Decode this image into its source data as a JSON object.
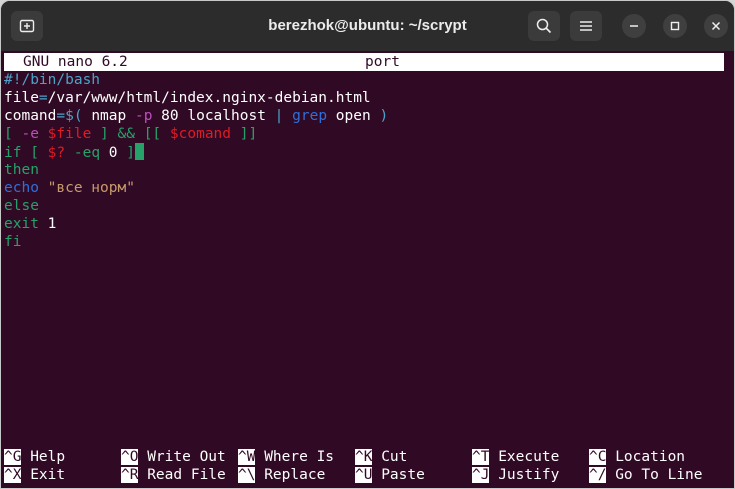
{
  "window": {
    "title": "berezhok@ubuntu: ~/scrypt",
    "icons": [
      "new-tab-icon",
      "search-icon",
      "hamburger-menu-icon",
      "minimize-icon",
      "maximize-icon",
      "close-icon"
    ]
  },
  "nano": {
    "version": "GNU nano 6.2",
    "filename": "port"
  },
  "code_lines": [
    [
      {
        "t": "#!/bin/bash",
        "c": "#4ba2c9"
      }
    ],
    [
      {
        "t": "file",
        "c": "#ffffff"
      },
      {
        "t": "=",
        "c": "#4ba2c9"
      },
      {
        "t": "/var/www/html/index.nginx-debian.html",
        "c": "#ffffff"
      }
    ],
    [
      {
        "t": "comand",
        "c": "#ffffff"
      },
      {
        "t": "=$( ",
        "c": "#4ba2c9"
      },
      {
        "t": "nmap ",
        "c": "#ffffff"
      },
      {
        "t": "-p",
        "c": "#bf4cbf"
      },
      {
        "t": " 80 localhost ",
        "c": "#ffffff"
      },
      {
        "t": "| ",
        "c": "#4ba2c9"
      },
      {
        "t": "grep",
        "c": "#2f6fd9"
      },
      {
        "t": " open ",
        "c": "#ffffff"
      },
      {
        "t": ")",
        "c": "#4ba2c9"
      }
    ],
    [
      {
        "t": "[ ",
        "c": "#26a269"
      },
      {
        "t": "-e",
        "c": "#bf4cbf"
      },
      {
        "t": " ",
        "c": "#26a269"
      },
      {
        "t": "$file",
        "c": "#e01b24"
      },
      {
        "t": " ] && [[ ",
        "c": "#26a269"
      },
      {
        "t": "$comand",
        "c": "#e01b24"
      },
      {
        "t": " ]]",
        "c": "#26a269"
      }
    ],
    [
      {
        "t": "if [ ",
        "c": "#26a269"
      },
      {
        "t": "$?",
        "c": "#e01b24"
      },
      {
        "t": " -eq ",
        "c": "#26a269"
      },
      {
        "t": "0",
        "c": "#ffffff"
      },
      {
        "t": " ]",
        "c": "#26a269"
      }
    ],
    [
      {
        "t": "then",
        "c": "#26a269"
      }
    ],
    [
      {
        "t": "echo",
        "c": "#2f6fd9"
      },
      {
        "t": " ",
        "c": "#ffffff"
      },
      {
        "t": "\"все норм\"",
        "c": "#c79a6b"
      }
    ],
    [
      {
        "t": "else",
        "c": "#26a269"
      }
    ],
    [
      {
        "t": "exit ",
        "c": "#26a269"
      },
      {
        "t": "1",
        "c": "#ffffff"
      }
    ],
    [
      {
        "t": "fi",
        "c": "#26a269"
      }
    ]
  ],
  "shortcuts": [
    [
      {
        "key": "^G",
        "label": "Help"
      },
      {
        "key": "^O",
        "label": "Write Out"
      },
      {
        "key": "^W",
        "label": "Where Is"
      },
      {
        "key": "^K",
        "label": "Cut"
      },
      {
        "key": "^T",
        "label": "Execute"
      },
      {
        "key": "^C",
        "label": "Location"
      }
    ],
    [
      {
        "key": "^X",
        "label": "Exit"
      },
      {
        "key": "^R",
        "label": "Read File"
      },
      {
        "key": "^\\",
        "label": "Replace"
      },
      {
        "key": "^U",
        "label": "Paste"
      },
      {
        "key": "^J",
        "label": "Justify"
      },
      {
        "key": "^/",
        "label": "Go To Line"
      }
    ]
  ],
  "colors": {
    "terminal_bg": "#300a24",
    "titlebar_bg": "#2c2c2c",
    "cursor": "#26a269"
  }
}
